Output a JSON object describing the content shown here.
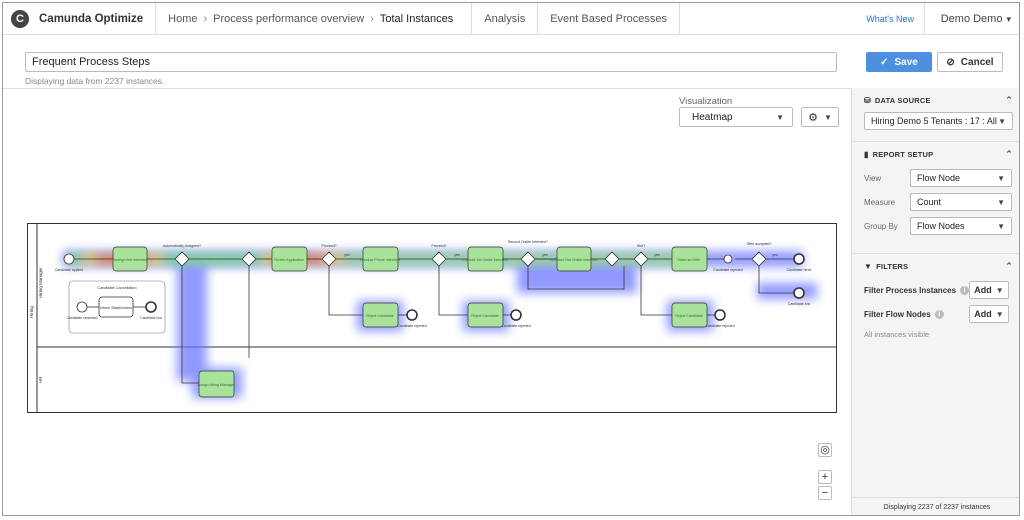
{
  "header": {
    "brand": "Camunda Optimize",
    "logo_letter": "C",
    "breadcrumb": [
      "Home",
      "Process performance overview",
      "Total Instances"
    ],
    "nav": [
      "Analysis",
      "Event Based Processes"
    ],
    "whats_new": "What's New",
    "user": "Demo Demo"
  },
  "report": {
    "title": "Frequent Process Steps",
    "subtitle": "Displaying data from 2237 instances.",
    "save_label": "Save",
    "cancel_label": "Cancel"
  },
  "visualization": {
    "label": "Visualization",
    "selected": "Heatmap"
  },
  "diagram": {
    "lanes": [
      "Hiring Manager",
      "HR"
    ],
    "pool": "Hiring",
    "subprocess": {
      "title": "Candidate Cancellation",
      "start": "Candidate cancelled",
      "task": "Inform Stakeholders",
      "end": "Candidate lost"
    },
    "tasks": [
      "Arrange first interview",
      "Screen Application",
      "Conduct Phone Interview",
      "Conduct 1st Onsite Interview",
      "Conduct 2nd Onsite Interview",
      "Make an Offer",
      "Reject Candidate",
      "Reject Candidate",
      "Reject Candidate",
      "Assign Hiring Manager"
    ],
    "gateways": [
      "Automatically Assigned?",
      "Proceed?",
      "Proceed?",
      "Second Onsite Interview?",
      "Hire?",
      "Offer accepted?"
    ],
    "flow_labels": [
      "yes",
      "yes",
      "yes",
      "yes",
      "yes"
    ],
    "events": [
      "Candidate applied",
      "Candidate hired",
      "Candidate lost",
      "Candidate rejected",
      "Candidate rejected",
      "Candidate rejected",
      "Candidate rejected"
    ]
  },
  "panel": {
    "data_source": {
      "title": "DATA SOURCE",
      "selected": "Hiring Demo 5 Tenants : 17 : All"
    },
    "report_setup": {
      "title": "REPORT SETUP",
      "view_label": "View",
      "view_value": "Flow Node",
      "measure_label": "Measure",
      "measure_value": "Count",
      "groupby_label": "Group By",
      "groupby_value": "Flow Nodes"
    },
    "filters": {
      "title": "FILTERS",
      "process_label": "Filter Process Instances",
      "flow_label": "Filter Flow Nodes",
      "add_label": "Add",
      "note": "All instances visible"
    },
    "footer": "Displaying 2237 of 2237 instances"
  },
  "colors": {
    "accent": "#4d90e0",
    "task_fill": "#a8e29b",
    "heat_hot": "#ff4a1c",
    "heat_cold": "#6c78ff"
  }
}
